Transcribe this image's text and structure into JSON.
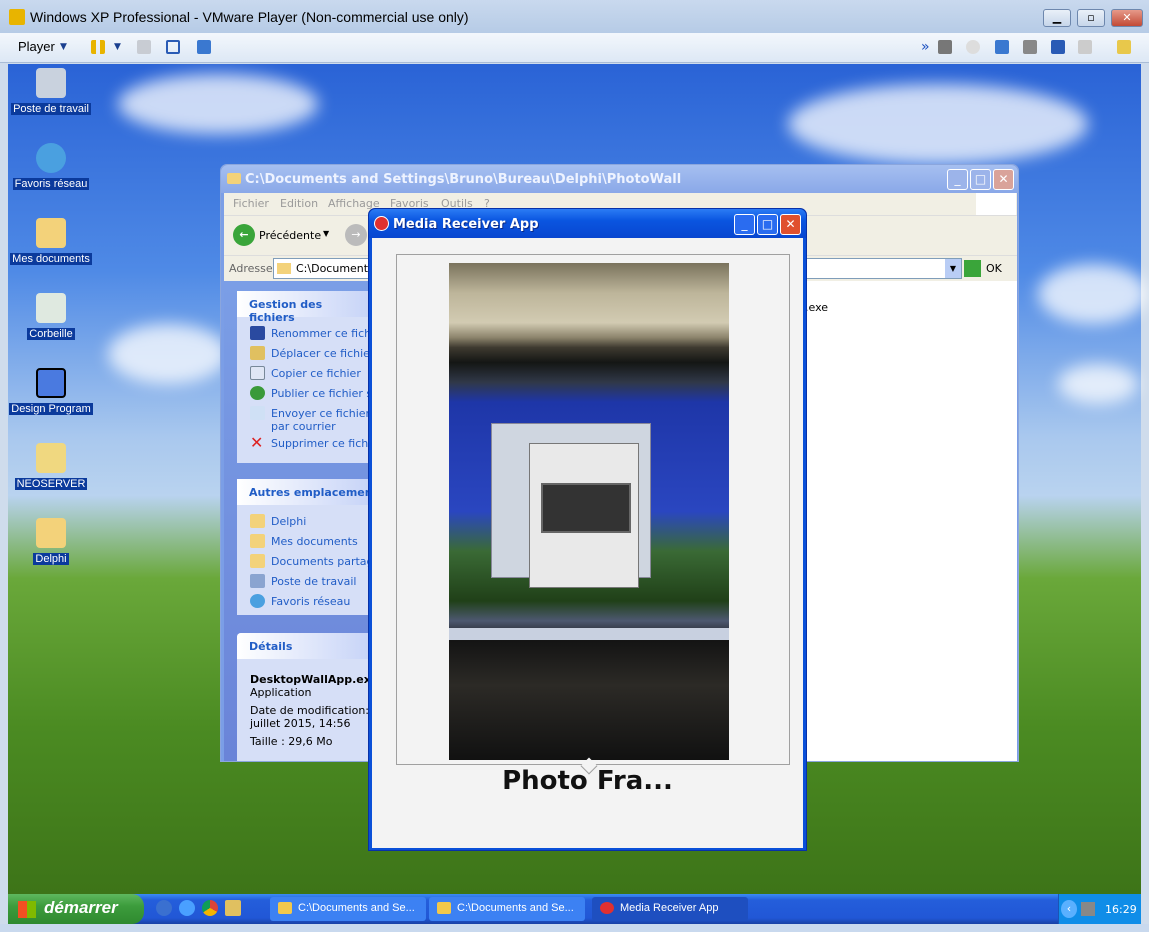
{
  "vmware": {
    "title": "Windows XP Professional - VMware Player (Non-commercial use only)",
    "player_menu": "Player",
    "window_buttons": [
      "minimize",
      "maximize",
      "close"
    ]
  },
  "desktop_icons": [
    {
      "label": "Poste de travail",
      "icon": "computer-icon"
    },
    {
      "label": "Favoris réseau",
      "icon": "network-icon"
    },
    {
      "label": "Mes documents",
      "icon": "documents-folder-icon"
    },
    {
      "label": "Corbeille",
      "icon": "recycle-bin-icon"
    },
    {
      "label": "Design Program",
      "icon": "design-program-icon"
    },
    {
      "label": "NEOSERVER",
      "icon": "shortcut-icon"
    },
    {
      "label": "Delphi",
      "icon": "folder-icon"
    }
  ],
  "explorer": {
    "title": "C:\\Documents and Settings\\Bruno\\Bureau\\Delphi\\PhotoWall",
    "menu": [
      "Fichier",
      "Edition",
      "Affichage",
      "Favoris",
      "Outils",
      "?"
    ],
    "back_label": "Précédente",
    "address_label": "Adresse",
    "address_value": "C:\\Documents and Settings\\Bruno\\Bureau\\Delphi\\PhotoWall",
    "go_label": "OK",
    "file_visible": ".exe",
    "tasks": {
      "title": "Gestion des fichiers",
      "items": [
        "Renommer ce fichier",
        "Déplacer ce fichier",
        "Copier ce fichier",
        "Publier ce fichier sur le Web",
        "Envoyer ce fichier par courrier électronique",
        "Supprimer ce fichier"
      ]
    },
    "places": {
      "title": "Autres emplacements",
      "items": [
        "Delphi",
        "Mes documents",
        "Documents partagés",
        "Poste de travail",
        "Favoris réseau"
      ]
    },
    "details": {
      "title": "Détails",
      "name": "DesktopWallApp.exe",
      "type": "Application",
      "modified": "Date de modification: ma",
      "modified2": "juillet 2015, 14:56",
      "size": "Taille : 29,6 Mo"
    }
  },
  "media_app": {
    "title": "Media Receiver App",
    "caption": "Photo Fra..."
  },
  "taskbar": {
    "start": "démarrer",
    "tasks": [
      "C:\\Documents and Se...",
      "C:\\Documents and Se...",
      "Media Receiver App"
    ],
    "clock": "16:29"
  }
}
